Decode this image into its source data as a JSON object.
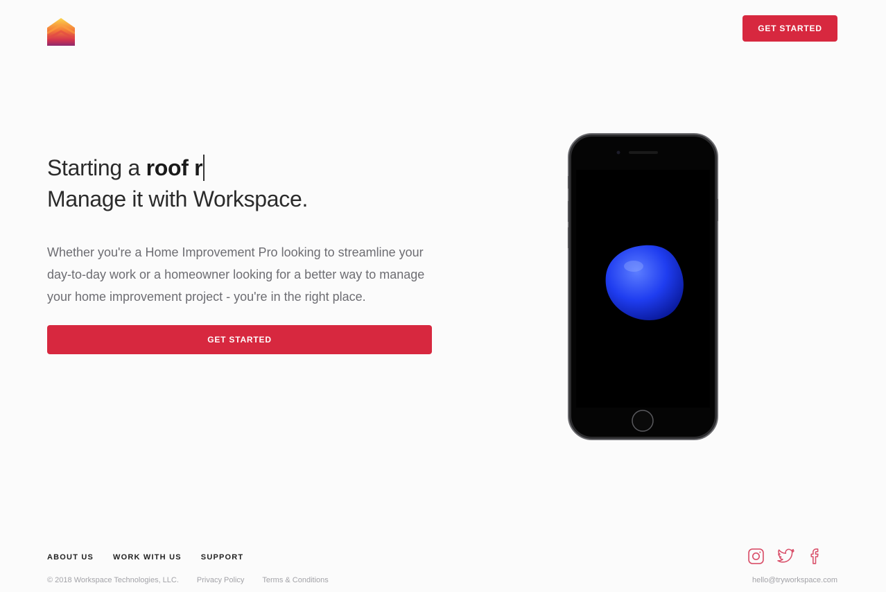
{
  "header": {
    "logo_icon": "workspace-house-logo",
    "cta_label": "GET STARTED"
  },
  "hero": {
    "headline_prefix": "Starting a ",
    "headline_typed": "roof r",
    "headline_line2": "Manage it with Workspace.",
    "lede": "Whether you're a Home Improvement Pro looking to streamline your day-to-day work or a homeowner looking for a better way to manage your home improvement project - you're in the right place.",
    "cta_label": "GET STARTED"
  },
  "phone_image": {
    "icon": "iphone-mockup"
  },
  "footer": {
    "nav": [
      "ABOUT US",
      "WORK WITH US",
      "SUPPORT"
    ],
    "copyright": "© 2018 Workspace Technologies, LLC.",
    "privacy": "Privacy Policy",
    "terms": "Terms & Conditions",
    "email": "hello@tryworkspace.com",
    "social_icons": [
      "instagram-icon",
      "twitter-icon",
      "facebook-icon"
    ]
  },
  "colors": {
    "accent": "#d7283f",
    "background": "#fbfbfb",
    "social": "#d9506a"
  }
}
